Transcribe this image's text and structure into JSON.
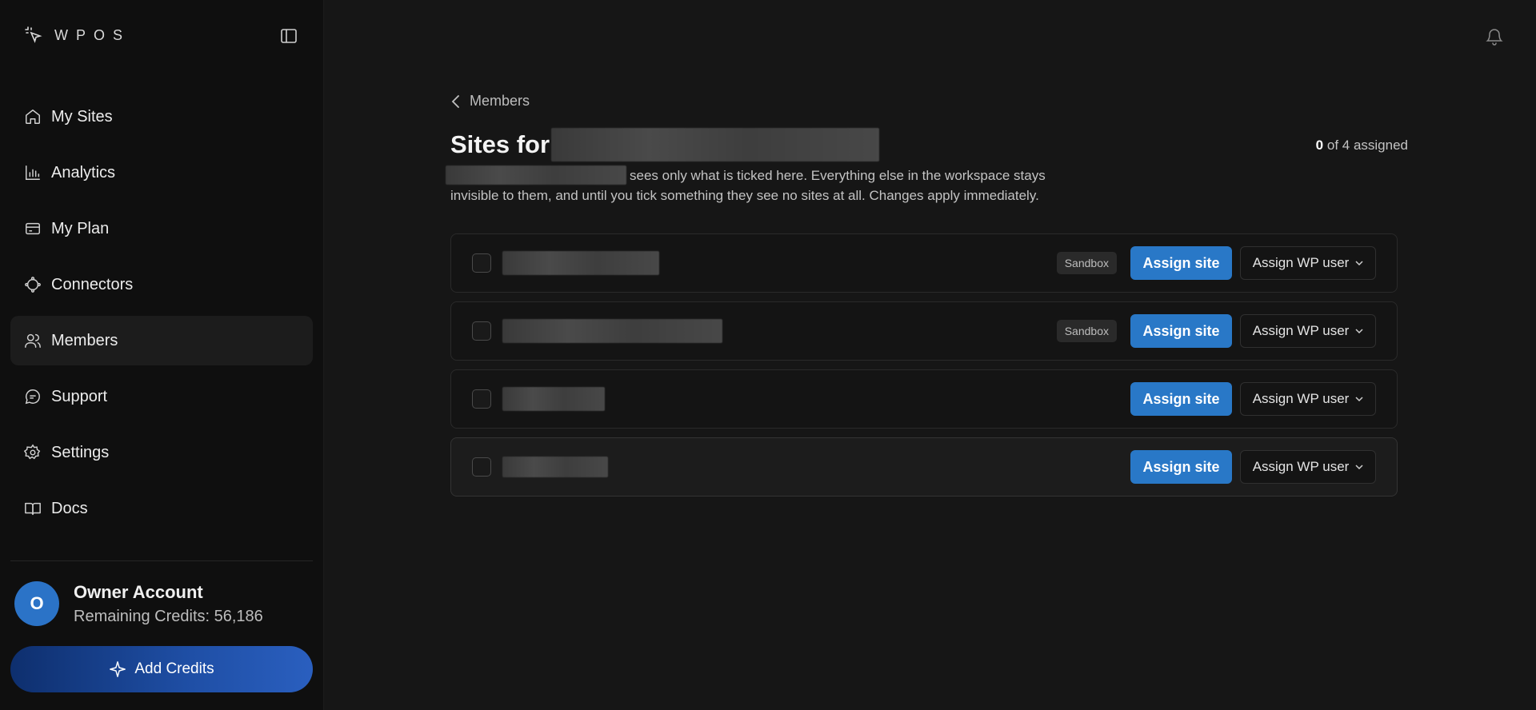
{
  "brand": {
    "name": "WPOS"
  },
  "sidebar": {
    "items": [
      {
        "label": "My Sites",
        "icon": "home-icon"
      },
      {
        "label": "Analytics",
        "icon": "chart-icon"
      },
      {
        "label": "My Plan",
        "icon": "card-icon"
      },
      {
        "label": "Connectors",
        "icon": "connector-icon"
      },
      {
        "label": "Members",
        "icon": "users-icon",
        "active": true
      },
      {
        "label": "Support",
        "icon": "chat-icon"
      },
      {
        "label": "Settings",
        "icon": "gear-icon"
      },
      {
        "label": "Docs",
        "icon": "book-icon"
      }
    ]
  },
  "account": {
    "initial": "O",
    "name": "Owner Account",
    "credits": "Remaining Credits: 56,186",
    "add_credits_label": "Add Credits"
  },
  "page": {
    "back_label": "Members",
    "title_prefix": "Sites for",
    "assigned_count": "0",
    "assigned_suffix": "of 4 assigned",
    "description": "sees only what is ticked here. Everything else in the workspace stays invisible to them, and until you tick something they see no sites at all. Changes apply immediately."
  },
  "sites": [
    {
      "badge": "Sandbox",
      "assign_label": "Assign site",
      "wp_label": "Assign WP user"
    },
    {
      "badge": "Sandbox",
      "assign_label": "Assign site",
      "wp_label": "Assign WP user"
    },
    {
      "badge": "",
      "assign_label": "Assign site",
      "wp_label": "Assign WP user"
    },
    {
      "badge": "",
      "assign_label": "Assign site",
      "wp_label": "Assign WP user"
    }
  ],
  "colors": {
    "accent": "#2978c7",
    "avatar": "#2b73c7",
    "background": "#161616",
    "sidebar": "#0f0f0f"
  }
}
